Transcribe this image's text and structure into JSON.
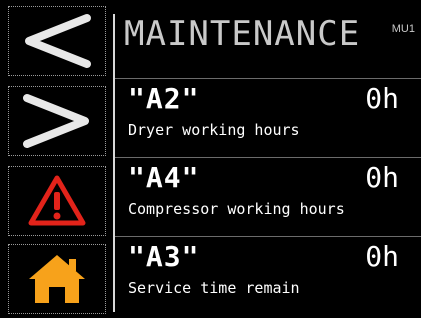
{
  "header": {
    "title": "MAINTENANCE",
    "screen_code": "MU1"
  },
  "sidebar": {
    "buttons": [
      {
        "name": "back",
        "icon": "chevron-left-icon"
      },
      {
        "name": "forward",
        "icon": "chevron-right-icon"
      },
      {
        "name": "alarm",
        "icon": "warning-icon",
        "color": "#e2231a"
      },
      {
        "name": "home",
        "icon": "home-icon",
        "color": "#f7a21b"
      }
    ]
  },
  "rows": [
    {
      "code": "\"A2\"",
      "value": "0h",
      "label": "Dryer working hours"
    },
    {
      "code": "\"A4\"",
      "value": "0h",
      "label": "Compressor working hours"
    },
    {
      "code": "\"A3\"",
      "value": "0h",
      "label": "Service time remain"
    }
  ],
  "colors": {
    "background": "#000000",
    "text": "#ffffff",
    "alarm": "#e2231a",
    "home": "#f7a21b"
  }
}
